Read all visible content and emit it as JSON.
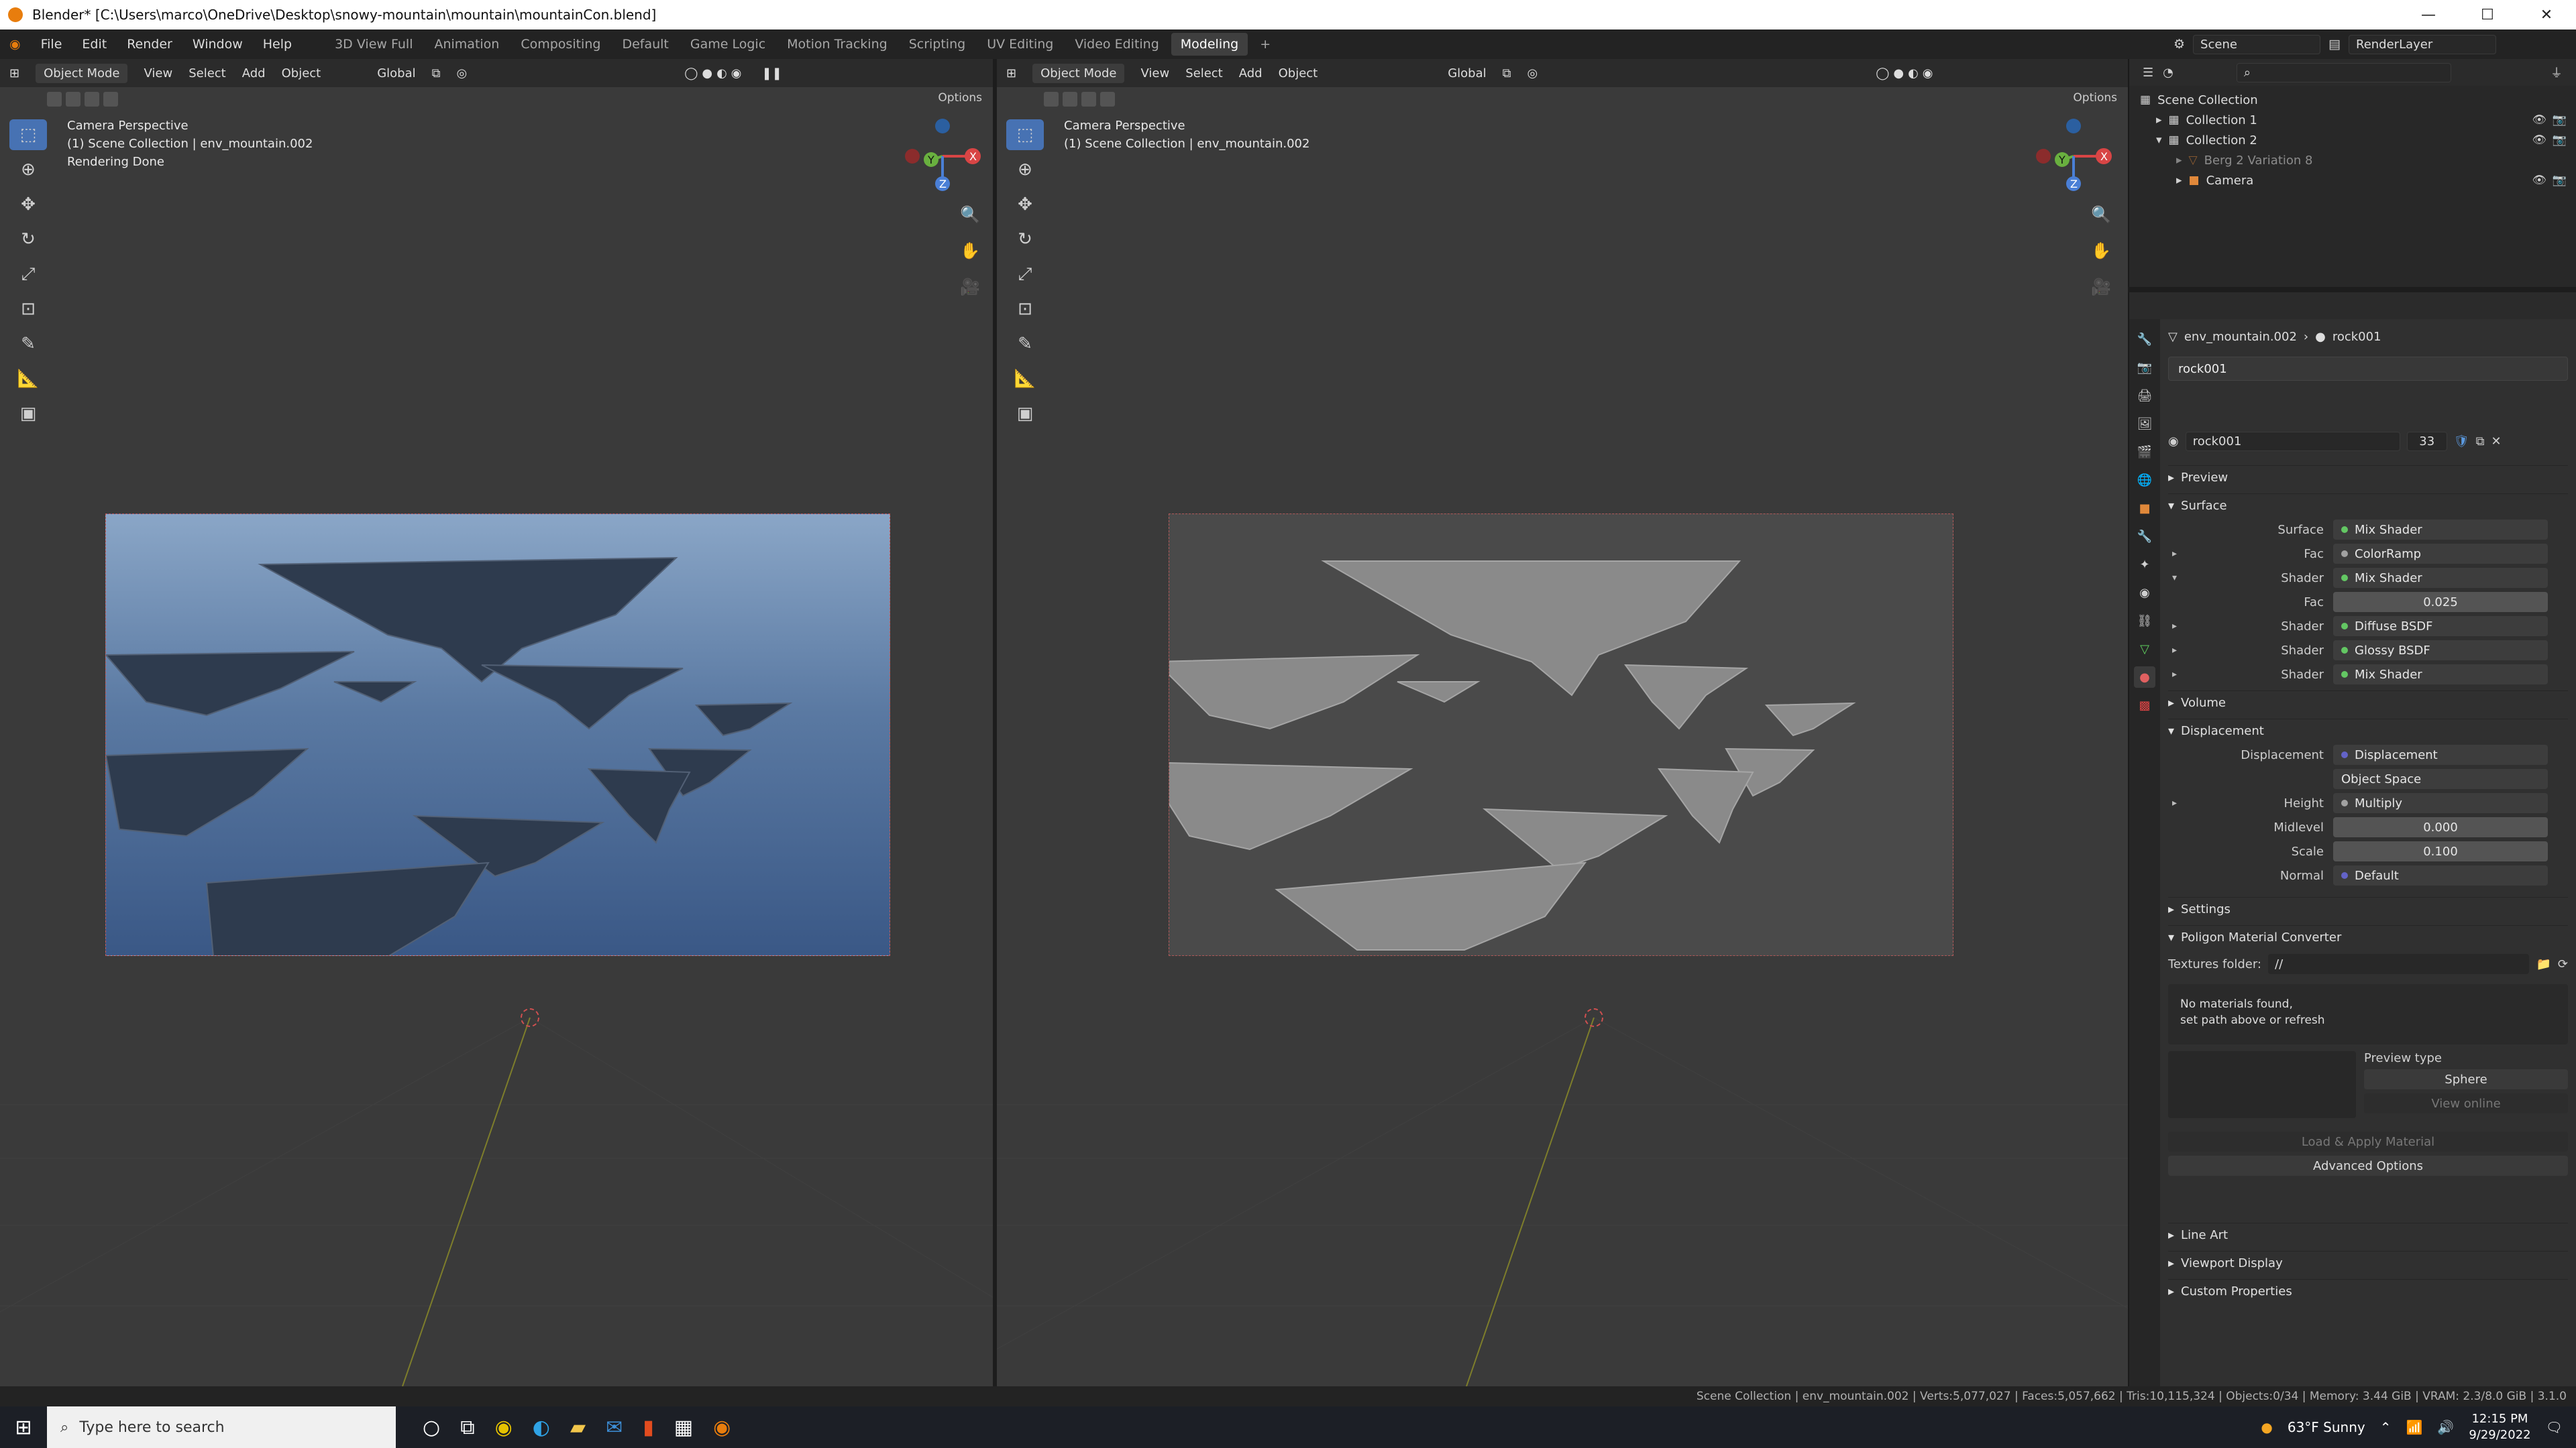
{
  "window": {
    "title": "Blender* [C:\\Users\\marco\\OneDrive\\Desktop\\snowy-mountain\\mountain\\mountainCon.blend]"
  },
  "menus": [
    "File",
    "Edit",
    "Render",
    "Window",
    "Help"
  ],
  "workspaces": [
    "3D View Full",
    "Animation",
    "Compositing",
    "Default",
    "Game Logic",
    "Motion Tracking",
    "Scripting",
    "UV Editing",
    "Video Editing",
    "Modeling"
  ],
  "active_workspace": "Modeling",
  "scene": {
    "name": "Scene",
    "layer": "RenderLayer"
  },
  "viewport_left": {
    "mode": "Object Mode",
    "menus": [
      "View",
      "Select",
      "Add",
      "Object"
    ],
    "transform": "Global",
    "options": "Options",
    "overlay": [
      "Camera Perspective",
      "(1) Scene Collection | env_mountain.002",
      "Rendering Done"
    ]
  },
  "viewport_right": {
    "mode": "Object Mode",
    "menus": [
      "View",
      "Select",
      "Add",
      "Object"
    ],
    "transform": "Global",
    "options": "Options",
    "overlay": [
      "Camera Perspective",
      "(1) Scene Collection | env_mountain.002"
    ]
  },
  "outliner": {
    "root": "Scene Collection",
    "items": [
      {
        "label": "Collection 1",
        "indent": 1
      },
      {
        "label": "Collection 2",
        "indent": 1
      },
      {
        "label": "Berg 2 Variation 8",
        "indent": 2
      },
      {
        "label": "Camera",
        "indent": 2
      }
    ]
  },
  "properties": {
    "breadcrumb": [
      "env_mountain.002",
      "rock001"
    ],
    "material_slot": "rock001",
    "material_name": "rock001",
    "users": "33",
    "panels": {
      "preview": "Preview",
      "surface": "Surface",
      "volume": "Volume",
      "displacement": "Displacement",
      "settings": "Settings",
      "converter": "Poligon Material Converter",
      "line_art": "Line Art",
      "viewport_display": "Viewport Display",
      "custom_props": "Custom Properties"
    },
    "surface_rows": [
      {
        "label": "Surface",
        "value": "Mix Shader",
        "dot": "green"
      },
      {
        "label": "Fac",
        "value": "ColorRamp",
        "dot": "grey",
        "arrow": "▸"
      },
      {
        "label": "Shader",
        "value": "Mix Shader",
        "dot": "green",
        "arrow": "▾"
      },
      {
        "label": "Fac",
        "value": "0.025",
        "num": true
      },
      {
        "label": "Shader",
        "value": "Diffuse BSDF",
        "dot": "green",
        "arrow": "▸"
      },
      {
        "label": "Shader",
        "value": "Glossy BSDF",
        "dot": "green",
        "arrow": "▸"
      },
      {
        "label": "Shader",
        "value": "Mix Shader",
        "dot": "green",
        "arrow": "▸"
      }
    ],
    "displacement_rows": [
      {
        "label": "Displacement",
        "value": "Displacement",
        "dot": "blue"
      },
      {
        "label": "",
        "value": "Object Space"
      },
      {
        "label": "Height",
        "value": "Multiply",
        "dot": "grey",
        "arrow": "▸"
      },
      {
        "label": "Midlevel",
        "value": "0.000",
        "num": true
      },
      {
        "label": "Scale",
        "value": "0.100",
        "num": true
      },
      {
        "label": "Normal",
        "value": "Default",
        "dot": "blue"
      }
    ],
    "converter": {
      "textures_label": "Textures folder:",
      "textures_value": "//",
      "no_mat_line1": "No materials found,",
      "no_mat_line2": "set path above or refresh",
      "preview_type_label": "Preview type",
      "preview_type": "Sphere",
      "view_online": "View online",
      "load_apply": "Load & Apply Material",
      "advanced": "Advanced Options"
    }
  },
  "statusbar": "Scene Collection | env_mountain.002 | Verts:5,077,027 | Faces:5,057,662 | Tris:10,115,324 | Objects:0/34 | Memory: 3.44 GiB | VRAM: 2.3/8.0 GiB | 3.1.0",
  "taskbar": {
    "search_placeholder": "Type here to search",
    "weather": "63°F  Sunny",
    "time": "12:15 PM",
    "date": "9/29/2022"
  }
}
